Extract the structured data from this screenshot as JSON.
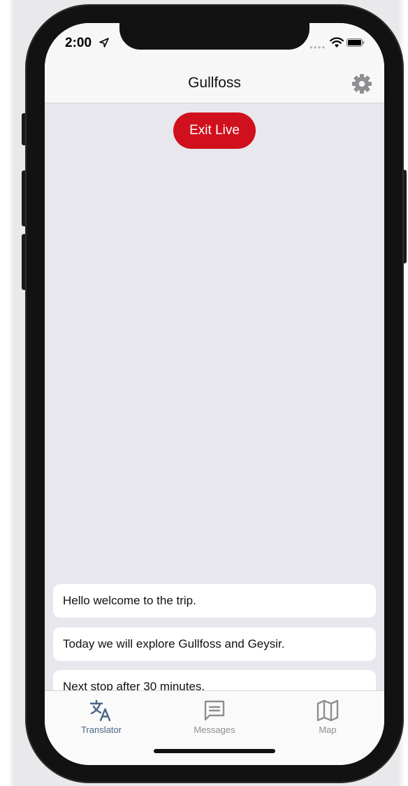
{
  "status_bar": {
    "time": "2:00"
  },
  "navbar": {
    "title": "Gullfoss",
    "settings_icon": "gear-icon"
  },
  "live": {
    "exit_label": "Exit Live",
    "accent_color": "#d0101c"
  },
  "messages": [
    {
      "text": "Hello welcome to the trip."
    },
    {
      "text": "Today we will explore Gullfoss and Geysir."
    },
    {
      "text": "Next stop after 30 minutes."
    }
  ],
  "tabs": [
    {
      "label": "Translator",
      "icon": "translate-icon",
      "selected": true,
      "color": "#4a6585"
    },
    {
      "label": "Messages",
      "icon": "message-icon",
      "selected": false,
      "color": "#8e8e93"
    },
    {
      "label": "Map",
      "icon": "map-icon",
      "selected": false,
      "color": "#8e8e93"
    }
  ]
}
